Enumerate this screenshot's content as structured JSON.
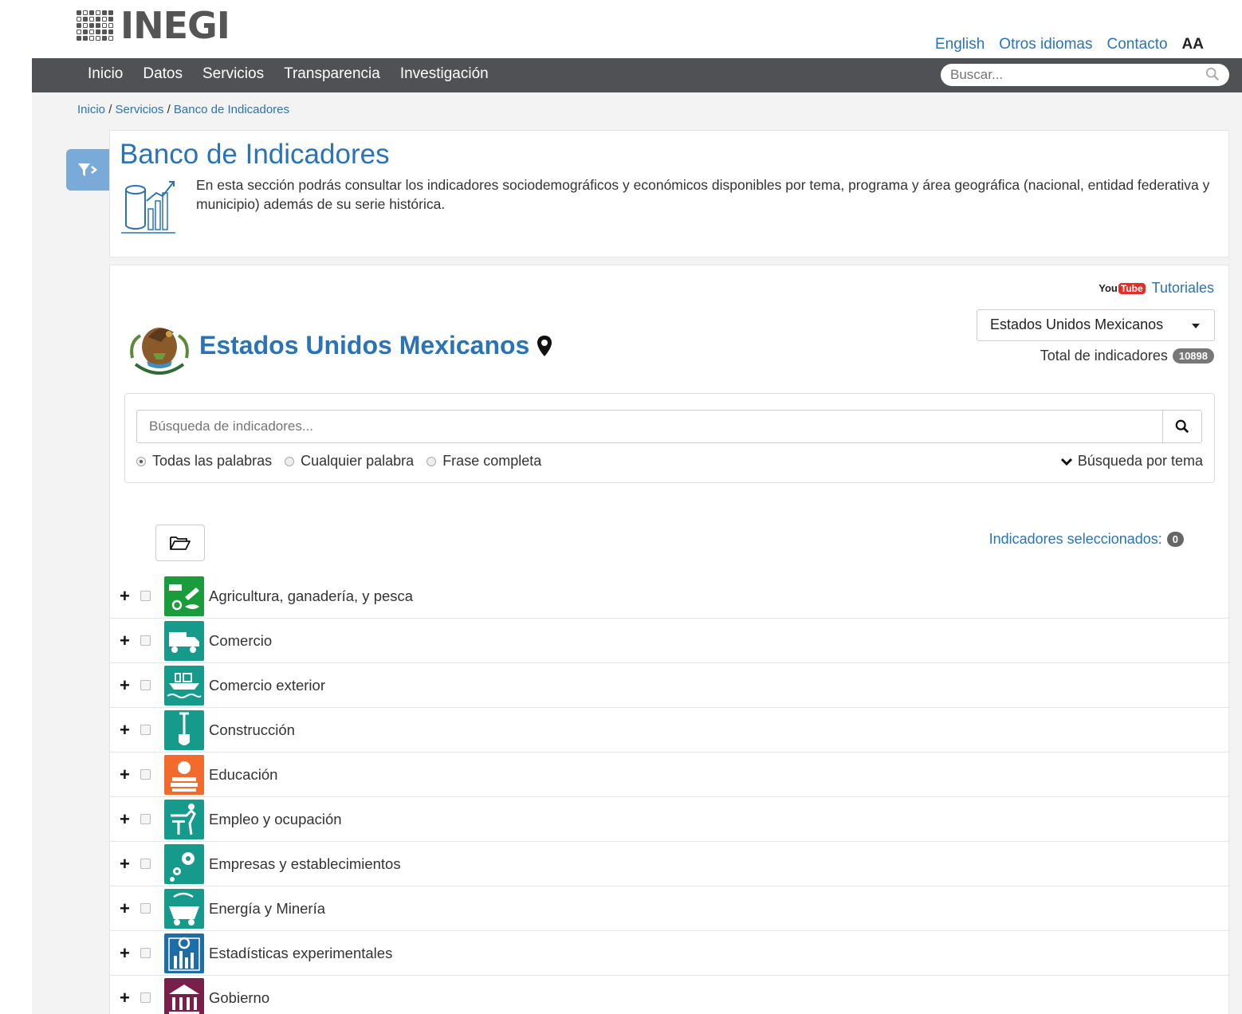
{
  "header": {
    "logo_text": "INEGI",
    "links": [
      "English",
      "Otros idiomas",
      "Contacto"
    ],
    "font_size_label": "AA"
  },
  "nav": {
    "items": [
      "Inicio",
      "Datos",
      "Servicios",
      "Transparencia",
      "Investigación"
    ],
    "search_placeholder": "Buscar..."
  },
  "breadcrumb": {
    "items": [
      "Inicio",
      "Servicios",
      "Banco de Indicadores"
    ],
    "separator": "/"
  },
  "intro": {
    "title": "Banco de Indicadores",
    "text": "En esta sección podrás consultar los indicadores sociodemográficos y económicos disponibles por tema, programa y área geográfica (nacional, entidad federativa y municipio) además de su serie histórica."
  },
  "main": {
    "youtube_label": "You",
    "youtube_tube": "Tube",
    "tutorials_label": "Tutoriales",
    "state_title": "Estados Unidos Mexicanos",
    "state_select_value": "Estados Unidos Mexicanos",
    "total_label": "Total de indicadores",
    "total_count": "10898",
    "search": {
      "placeholder": "Búsqueda de indicadores...",
      "options": [
        "Todas las palabras",
        "Cualquier palabra",
        "Frase completa"
      ],
      "selected_option": "Todas las palabras",
      "by_theme_label": "Búsqueda por tema"
    },
    "selected_label": "Indicadores seleccionados:",
    "selected_count": "0",
    "topics": [
      {
        "label": "Agricultura, ganadería, y pesca",
        "color": "#1a9b3c",
        "icon": "agriculture-icon"
      },
      {
        "label": "Comercio",
        "color": "#159a8c",
        "icon": "truck-icon"
      },
      {
        "label": "Comercio exterior",
        "color": "#159a8c",
        "icon": "ship-icon"
      },
      {
        "label": "Construcción",
        "color": "#159a8c",
        "icon": "shovel-icon"
      },
      {
        "label": "Educación",
        "color": "#f26b2c",
        "icon": "apple-books-icon"
      },
      {
        "label": "Empleo y ocupación",
        "color": "#159a8c",
        "icon": "worker-icon"
      },
      {
        "label": "Empresas y establecimientos",
        "color": "#159a8c",
        "icon": "gears-icon"
      },
      {
        "label": "Energía y Minería",
        "color": "#159a8c",
        "icon": "mining-cart-icon"
      },
      {
        "label": "Estadísticas experimentales",
        "color": "#1d6da8",
        "icon": "experimental-stats-icon"
      },
      {
        "label": "Gobierno",
        "color": "#7a1f4a",
        "icon": "government-building-icon"
      }
    ]
  }
}
